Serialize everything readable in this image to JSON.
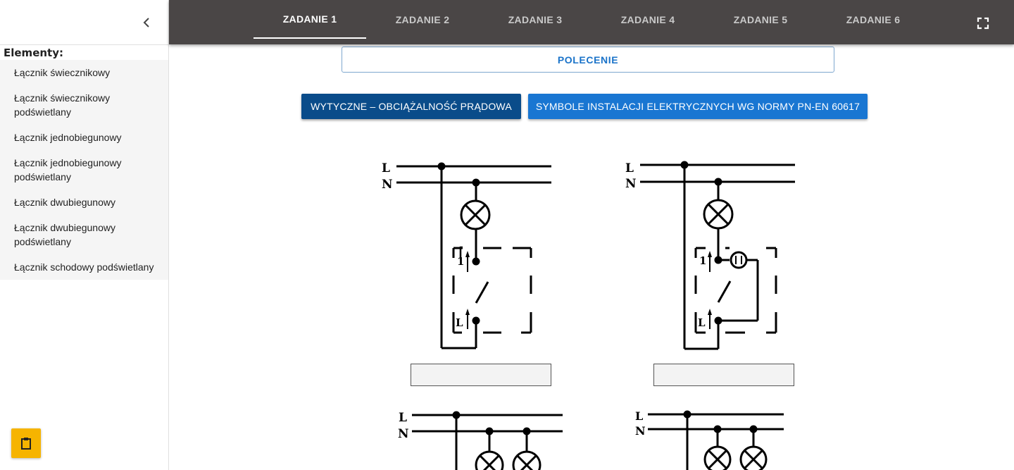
{
  "sidebar": {
    "heading": "Elementy:",
    "items": [
      {
        "label": "Łącznik świecznikowy"
      },
      {
        "label": "Łącznik świecznikowy podświetlany"
      },
      {
        "label": "Łącznik jednobiegunowy"
      },
      {
        "label": "Łącznik jednobiegunowy podświetlany"
      },
      {
        "label": "Łącznik dwubiegunowy"
      },
      {
        "label": "Łącznik dwubiegunowy podświetlany"
      },
      {
        "label": "Łącznik schodowy podświetlany"
      }
    ],
    "collapse_icon": "chevron-left-icon",
    "clipboard_icon": "clipboard-icon"
  },
  "tabs": [
    {
      "label": "ZADANIE 1",
      "active": true
    },
    {
      "label": "ZADANIE 2",
      "active": false
    },
    {
      "label": "ZADANIE 3",
      "active": false
    },
    {
      "label": "ZADANIE 4",
      "active": false
    },
    {
      "label": "ZADANIE 5",
      "active": false
    },
    {
      "label": "ZADANIE 6",
      "active": false
    }
  ],
  "fullscreen_icon": "fullscreen-icon",
  "main": {
    "polecenie_label": "POLECENIE",
    "guidelines_label": "WYTYCZNE – OBCIĄŻALNOŚĆ PRĄDOWA",
    "symbols_label": "SYMBOLE INSTALACJI ELEKTRYCZNYCH WG NORMY PN-EN 60617"
  },
  "diagram_labels": {
    "line": "L",
    "neutral": "N",
    "contact_1": "1"
  },
  "colors": {
    "topbar": "#4a4646",
    "accent_dark": "#0a4c8a",
    "accent_blue": "#1976d2",
    "clipboard_button": "#f6b400"
  }
}
